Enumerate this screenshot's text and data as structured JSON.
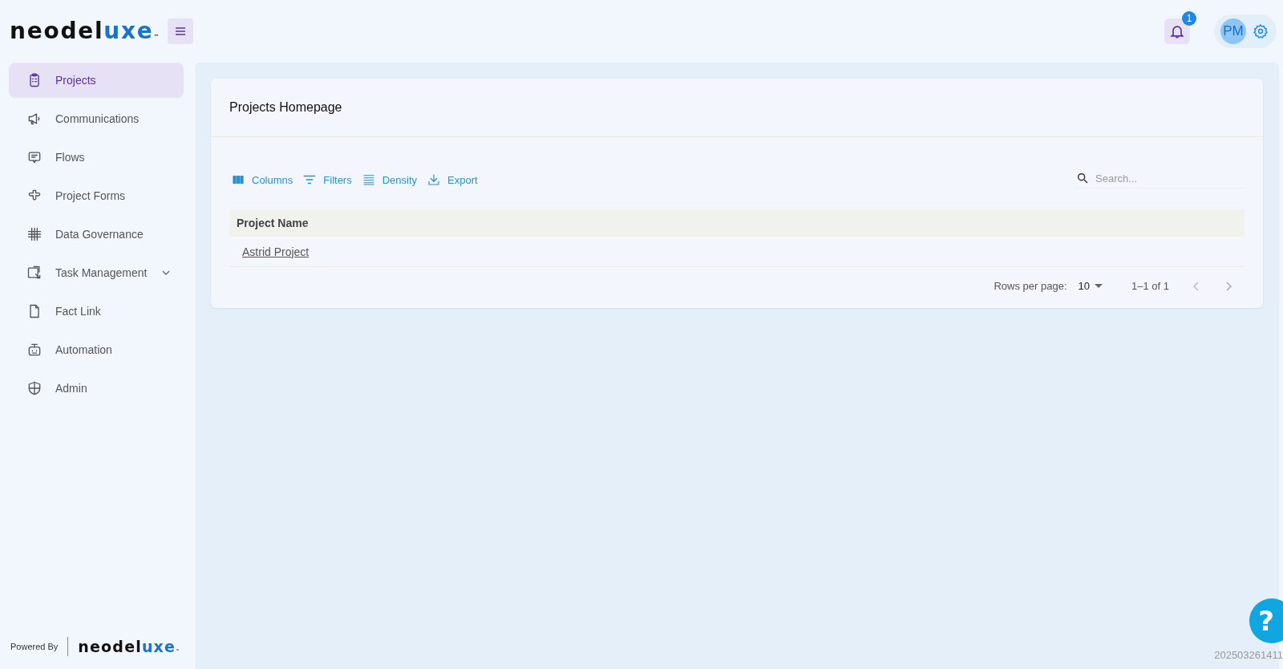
{
  "logo": {
    "main": "neodel",
    "accent": "uxe",
    "mark": "™"
  },
  "header": {
    "notifications": {
      "count": "1"
    },
    "avatar": {
      "initials": "PM"
    }
  },
  "sidebar": {
    "items": [
      {
        "label": "Projects",
        "selected": true,
        "expandable": false
      },
      {
        "label": "Communications",
        "selected": false,
        "expandable": false
      },
      {
        "label": "Flows",
        "selected": false,
        "expandable": false
      },
      {
        "label": "Project Forms",
        "selected": false,
        "expandable": false
      },
      {
        "label": "Data Governance",
        "selected": false,
        "expandable": false
      },
      {
        "label": "Task Management",
        "selected": false,
        "expandable": true
      },
      {
        "label": "Fact Link",
        "selected": false,
        "expandable": false
      },
      {
        "label": "Automation",
        "selected": false,
        "expandable": false
      },
      {
        "label": "Admin",
        "selected": false,
        "expandable": false
      }
    ],
    "footer": {
      "powered_by": "Powered By",
      "logo": {
        "main": "neodel",
        "accent": "uxe",
        "mark": "™"
      }
    }
  },
  "card": {
    "title": "Projects Homepage",
    "toolbar": [
      {
        "label": "Columns"
      },
      {
        "label": "Filters"
      },
      {
        "label": "Density"
      },
      {
        "label": "Export"
      }
    ],
    "search": {
      "placeholder": "Search..."
    },
    "table": {
      "columns": [
        "Project Name"
      ],
      "rows": [
        [
          "Astrid Project"
        ]
      ]
    },
    "pagination": {
      "rows_per_page_label": "Rows per page:",
      "rows_per_page": "10",
      "range": "1–1 of 1"
    }
  },
  "help": {
    "label": "?"
  },
  "version": "202503261411"
}
